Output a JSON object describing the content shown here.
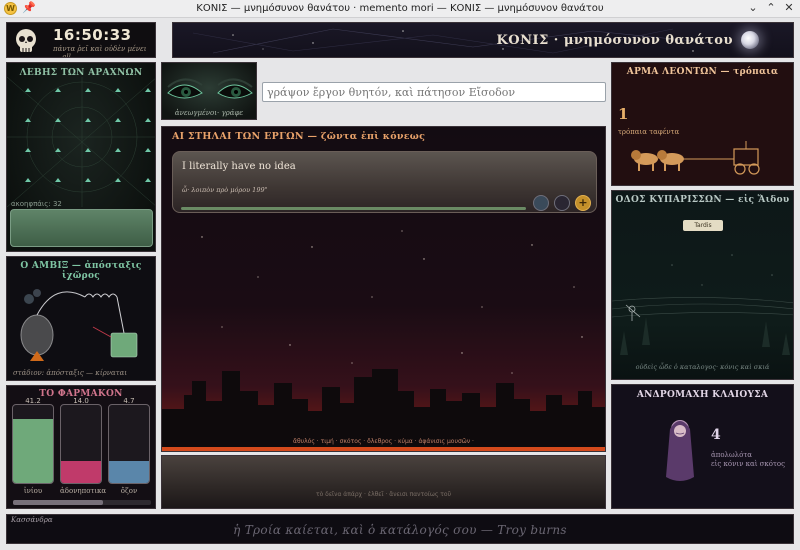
{
  "window": {
    "title": "ΚΟΝΙΣ — μνημόσυνον θανάτου · memento mori — ΚΟΝΙΣ — μνημόσυνον θανάτου",
    "app_icon": "W",
    "pin_icon": "pin-icon",
    "controls": [
      "chevron-down-icon",
      "chevron-up-icon",
      "close-icon"
    ]
  },
  "clock": {
    "time": "16:50:33",
    "motto": "πάντα ῥεῖ καὶ οὐδὲν μένει — all"
  },
  "header": {
    "title": "ΚΟΝΙΣ · μνημόσυνον θανάτου"
  },
  "lebes": {
    "title": "ΛΕΒΗΣ ΤΩΝ ΑΡΑΧΝΩΝ",
    "count_label": "ακοηφπάις: 32"
  },
  "ambix": {
    "title": "Ο ΑΜΒΙΞ — ἀπόσταξις ἰχῶρος",
    "caption": "στάδιον: ἀπόσταξις — κίρναται"
  },
  "pharmakon": {
    "title": "ΤΟ ΦΑΡΜΑΚΟΝ",
    "vials": [
      {
        "value": "41.2",
        "label": "ἰνίου",
        "color": "#6fa97a"
      },
      {
        "value": "14.0",
        "label": "ἀδονηποτικα",
        "color": "#c03a6a"
      },
      {
        "value": "4.7",
        "label": "ὄζον",
        "color": "#5a86aa"
      }
    ],
    "progress": 0.65
  },
  "eyes": {
    "caption": "ἀνεωγμένοι· γράφε"
  },
  "entry": {
    "placeholder": "γράψον ἔργον θνητόν, καὶ πάτησον Εἴσοδον"
  },
  "stelai": {
    "title": "ΑΙ ΣΤΗΛΑΙ ΤΩΝ ΕΡΓΩΝ — ζῶντα ἐπὶ κόνεως",
    "stele": {
      "text": "I literally have no idea",
      "meta": "ὦ· λοιπὸν πρὸ μόρου 199\"",
      "progress": 0.83
    },
    "city_caption": "ἄθυλός · τιμή · σκότος · ὄλεθρος · κύμα · ἀφάνισις μουσῶν ·"
  },
  "bottom_panel": {
    "caption": "τὸ δεῖνα ἀπάρχ · ἐλθεῖ · ἄνεισι παντοίως τοῦ"
  },
  "arma": {
    "title": "ΑΡΜΑ ΛΕΟΝΤΩΝ — τρόπαια",
    "count": "1",
    "label": "τρόπαια ταφέντα"
  },
  "hodos": {
    "title": "ΟΔΟΣ ΚΥΠΑΡΙΣΣΩΝ — εἰς Ἅιδου",
    "badge": "Tardis",
    "caption": "οὐδεὶς ὧδε ὁ καταλογος· κόνις καὶ σκιά"
  },
  "andromache": {
    "title": "ΑΝΔΡΟΜΑΧΗ ΚΛΑΙΟΥΣΑ",
    "count": "4",
    "label1": "ἀπολωλότα",
    "label2": "εἰς κόνιν καὶ σκότος"
  },
  "footer": {
    "cassandra": "Κασσάνδρα",
    "prophecy": "ἡ Τροία καίεται, καὶ ὁ κατάλογός σου — Troy burns"
  }
}
